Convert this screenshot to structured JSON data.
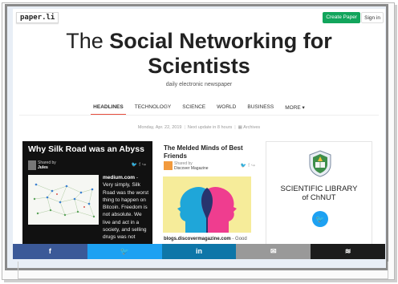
{
  "header": {
    "logo": "paper.li",
    "create_label": "Create Paper",
    "signin_label": "Sign in"
  },
  "masthead": {
    "title_prefix": "The",
    "title_line1": "Social Networking for",
    "title_line2": "Scientists",
    "subtitle": "daily electronic newspaper"
  },
  "nav": {
    "items": [
      "HEADLINES",
      "TECHNOLOGY",
      "SCIENCE",
      "WORLD",
      "BUSINESS",
      "MORE ▾"
    ],
    "active": "HEADLINES"
  },
  "dateline": {
    "date": "Monday, Apr. 22, 2019",
    "next_update": "Next update in 8 hours",
    "archives": "Archives"
  },
  "articles": [
    {
      "title": "Why Silk Road was an Abyss",
      "shared_by": "Shared by",
      "author": "Jules",
      "source": "medium.com",
      "snippet": "Very simply, Silk Road was the worst thing to happen on Bitcoin. Freedom is not absolute. We live and act in a society, and selling drugs was not"
    },
    {
      "title": "The Melded Minds of Best Friends",
      "shared_by": "Shared by",
      "author": "Discover Magazine",
      "source": "blogs.discovermagazine.com",
      "snippet": "Good"
    }
  ],
  "sidebar_widget": {
    "title_line1": "SCIENTIFIC LIBRARY",
    "title_line2": "of ChNUT"
  },
  "sharebar": {
    "facebook_glyph": "f",
    "twitter_glyph": "🐦",
    "linkedin_glyph": "in",
    "mail_glyph": "✉",
    "buffer_glyph": "≋"
  },
  "colors": {
    "create_button": "#12a55c",
    "nav_active_underline": "#e74c3c",
    "facebook": "#3b5998",
    "twitter": "#1da1f2",
    "linkedin": "#0e76a8",
    "mail": "#999999",
    "buffer": "#1c1c1c"
  }
}
